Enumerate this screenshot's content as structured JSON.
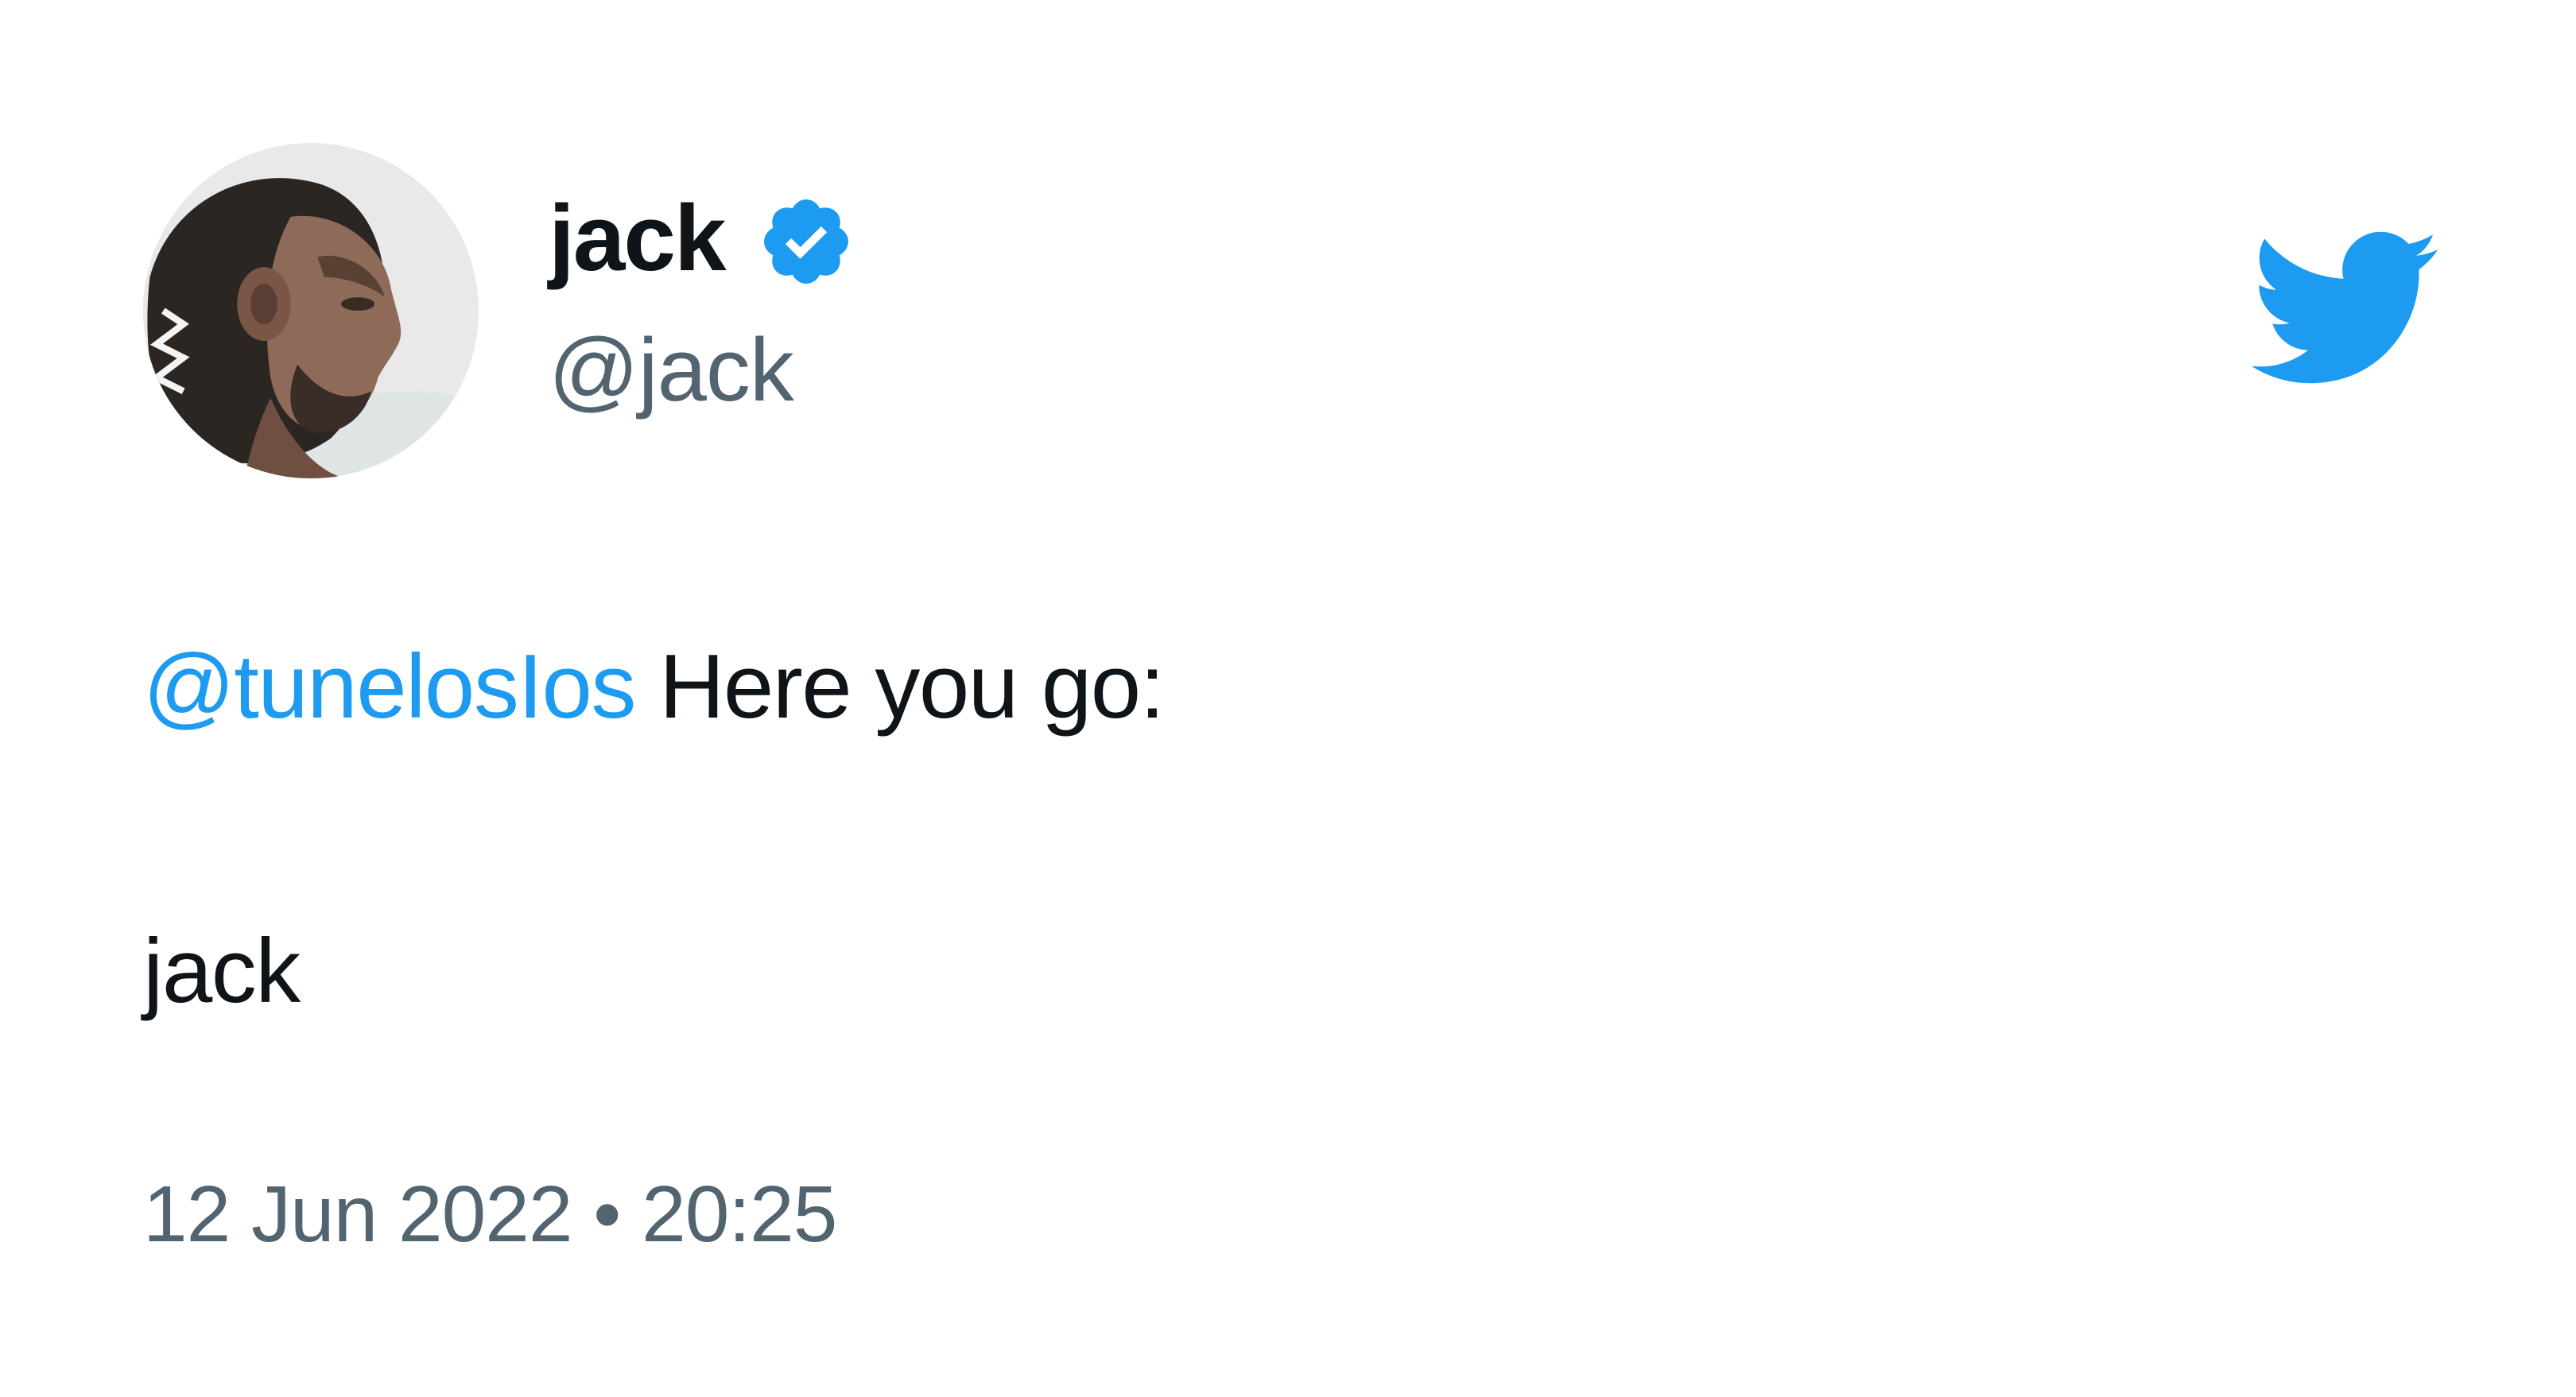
{
  "author": {
    "display_name": "jack",
    "handle": "@jack",
    "verified": true
  },
  "tweet": {
    "mention": "@tunelosIos",
    "text_after_mention": " Here you go:",
    "second_line": "jack"
  },
  "meta": {
    "date": "12 Jun 2022",
    "separator": " • ",
    "time": "20:25"
  },
  "icons": {
    "brand_logo": "twitter-bird-icon",
    "verified_badge": "verified-badge-icon"
  },
  "colors": {
    "brand_blue": "#1d9bf0",
    "text": "#0f1419",
    "muted": "#536471"
  }
}
